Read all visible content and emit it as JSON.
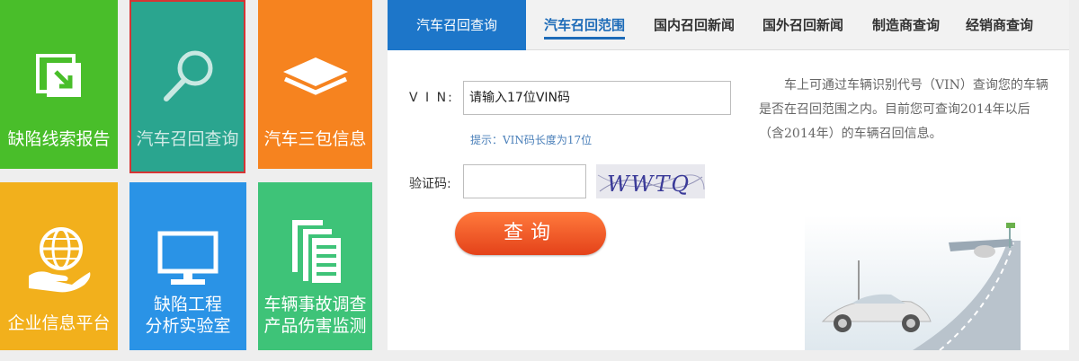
{
  "tiles": [
    {
      "label": "缺陷线索报告",
      "icon": "report-icon",
      "color": "#49be2a"
    },
    {
      "label": "汽车召回查询",
      "icon": "magnifier-icon",
      "color": "#2aa58f"
    },
    {
      "label": "汽车三包信息",
      "icon": "layers-icon",
      "color": "#f6831f"
    },
    {
      "label": "企业信息平台",
      "icon": "globe-hand-icon",
      "color": "#f2b01c"
    },
    {
      "label1": "缺陷工程",
      "label2": "分析实验室",
      "icon": "monitor-icon",
      "color": "#2a93e6"
    },
    {
      "label1": "车辆事故调查",
      "label2": "产品伤害监测",
      "icon": "documents-icon",
      "color": "#3ec378"
    }
  ],
  "tabs": {
    "main": "汽车召回查询",
    "items": [
      "汽车召回范围",
      "国内召回新闻",
      "国外召回新闻",
      "制造商查询",
      "经销商查询"
    ]
  },
  "form": {
    "vin_label": "V I N:",
    "vin_value": "请输入17位VIN码",
    "hint": "提示：VIN码长度为17位",
    "captcha_label": "验证码:",
    "captcha_value": "",
    "captcha_text": "WWTQ",
    "submit": "查询"
  },
  "description": "车上可通过车辆识别代号（VIN）查询您的车辆是否在召回范围之内。目前您可查询2014年以后（含2014年）的车辆召回信息。"
}
